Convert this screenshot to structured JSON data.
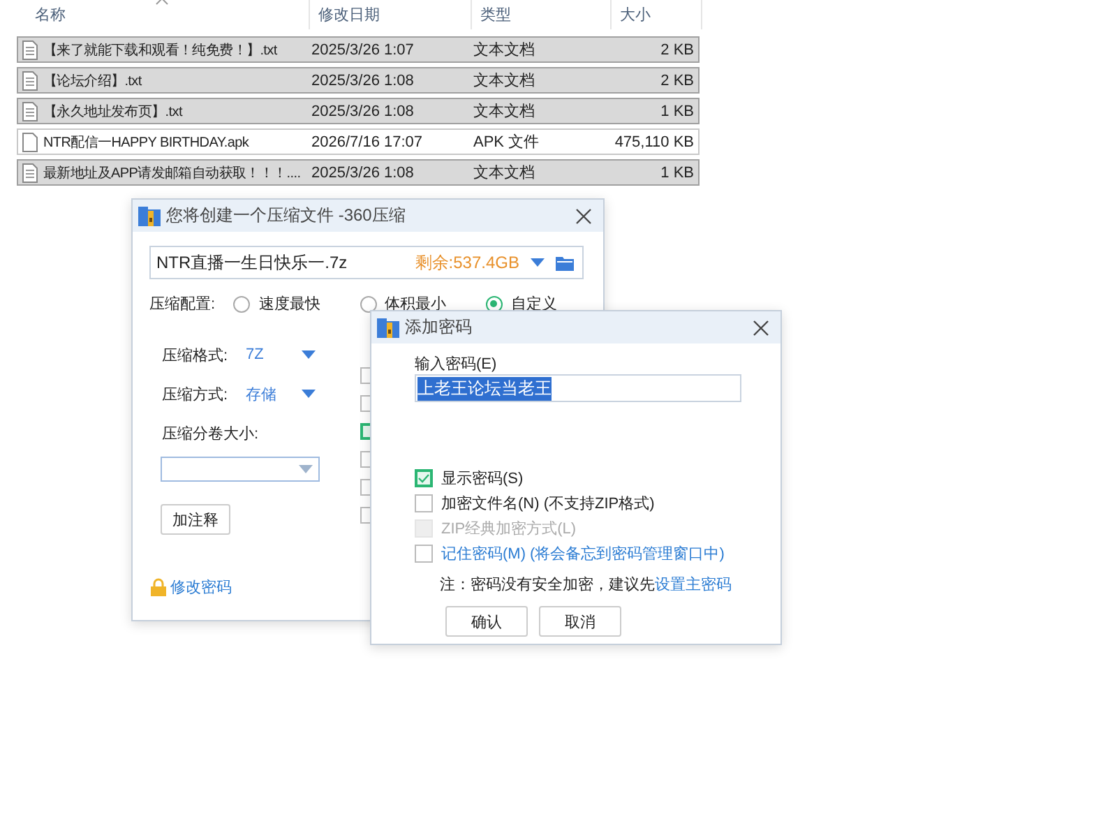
{
  "file_list": {
    "columns": [
      {
        "label": "名称",
        "sorted": true
      },
      {
        "label": "修改日期",
        "sorted": false
      },
      {
        "label": "类型",
        "sorted": false
      },
      {
        "label": "大小",
        "sorted": false
      }
    ],
    "rows": [
      {
        "name": "【来了就能下载和观看！纯免费！】.txt",
        "date": "2025/3/26 1:07",
        "type": "文本文档",
        "size": "2 KB",
        "kind": "text",
        "selected": true
      },
      {
        "name": "【论坛介绍】.txt",
        "date": "2025/3/26 1:08",
        "type": "文本文档",
        "size": "2 KB",
        "kind": "text",
        "selected": true
      },
      {
        "name": "【永久地址发布页】.txt",
        "date": "2025/3/26 1:08",
        "type": "文本文档",
        "size": "1 KB",
        "kind": "text",
        "selected": true
      },
      {
        "name": "NTR配信一HAPPY BIRTHDAY.apk",
        "date": "2026/7/16 17:07",
        "type": "APK 文件",
        "size": "475,110 KB",
        "kind": "blank",
        "selected": false
      },
      {
        "name": "最新地址及APP请发邮箱自动获取！！！....",
        "date": "2025/3/26 1:08",
        "type": "文本文档",
        "size": "1 KB",
        "kind": "text",
        "selected": true
      }
    ]
  },
  "compress_dialog": {
    "title": "您将创建一个压缩文件 -360压缩",
    "filename": "NTR直播一生日快乐一.7z",
    "free_space": "剩余:537.4GB",
    "config_label": "压缩配置:",
    "presets": [
      {
        "label": "速度最快",
        "selected": false
      },
      {
        "label": "体积最小",
        "selected": false
      },
      {
        "label": "自定义",
        "selected": true
      }
    ],
    "format_label": "压缩格式:",
    "format_value": "7Z",
    "method_label": "压缩方式:",
    "method_value": "存储",
    "split_label": "压缩分卷大小:",
    "comment_button": "加注释",
    "change_password_link": "修改密码",
    "options": [
      {
        "checked": false
      },
      {
        "checked": false
      },
      {
        "checked": true
      },
      {
        "checked": false
      },
      {
        "checked": false
      },
      {
        "checked": false
      }
    ]
  },
  "password_dialog": {
    "title": "添加密码",
    "field_label": "输入密码(E)",
    "value": "上老王论坛当老王",
    "value_selected": true,
    "options": [
      {
        "label": "显示密码(S)",
        "kind": "plain",
        "checked": true,
        "disabled": false
      },
      {
        "label": "加密文件名(N) (不支持ZIP格式)",
        "kind": "plain",
        "checked": false,
        "disabled": false
      },
      {
        "label": "ZIP经典加密方式(L)",
        "kind": "plain",
        "checked": false,
        "disabled": true
      },
      {
        "label": "记住密码(M) (将会备忘到密码管理窗口中)",
        "kind": "link",
        "checked": false,
        "disabled": false
      }
    ],
    "note": "注：密码没有安全加密，建议先",
    "note_link": "设置主密码",
    "buttons": [
      "确认",
      "取消"
    ]
  }
}
